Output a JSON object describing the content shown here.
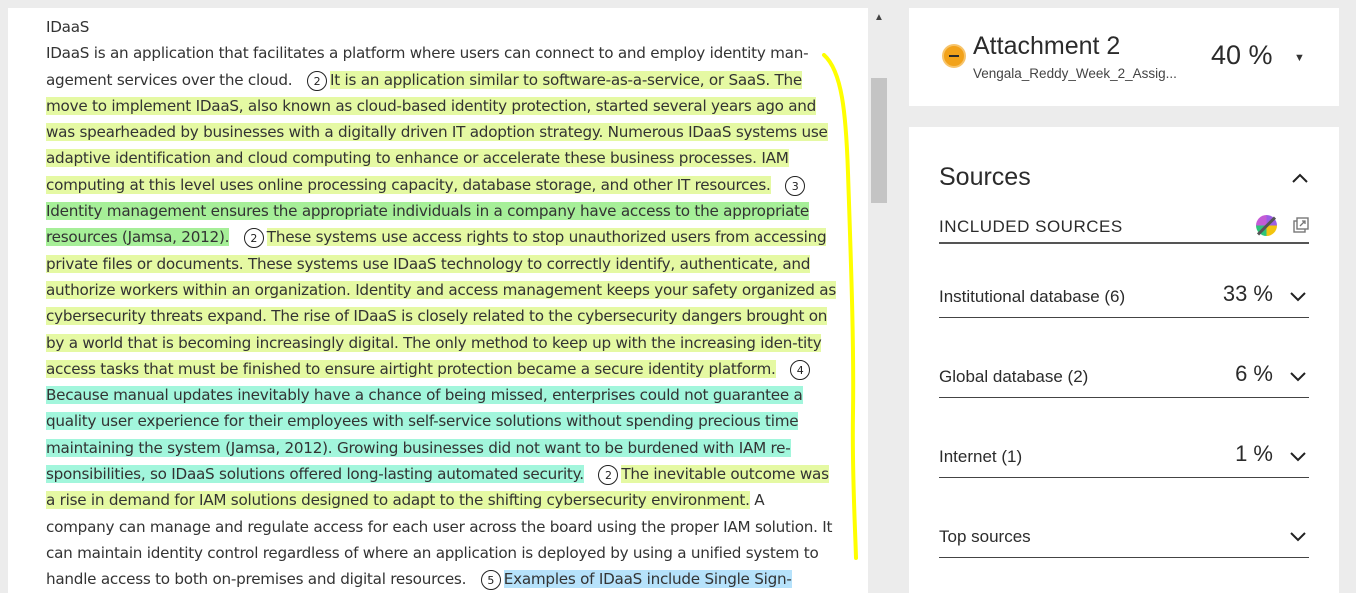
{
  "document": {
    "heading": "IDaaS",
    "segments": [
      {
        "text": "IDaaS is an application that facilitates a platform where users can connect to and employ identity man-agement services over the cloud."
      },
      {
        "marker": "2"
      },
      {
        "text": "It is an application similar to software-as-a-service, or SaaS. The move to implement IDaaS, also known as cloud-based identity protection, started several years ago and was spearheaded by businesses with a digitally driven IT adoption strategy. Numerous IDaaS systems use adaptive identification and cloud computing to enhance or accelerate these business processes. IAM computing at this level uses online processing capacity, database storage, and other IT resources.",
        "hl": "2"
      },
      {
        "marker": "3"
      },
      {
        "text": "Identity management ensures the appropriate individuals in a company have access to the appropriate resources (Jamsa, 2012).",
        "hl": "3"
      },
      {
        "marker": "2"
      },
      {
        "text": "These systems use access rights to stop unauthorized users from accessing private files or documents. These systems use IDaaS technology to correctly identify, authenticate, and authorize workers within an organization. Identity and access management keeps your safety organized as cybersecurity threats expand. The rise of IDaaS is closely related to the cybersecurity dangers brought on by a world that is becoming increasingly digital. The only method to keep up with the increasing iden-tity access tasks that must be finished to ensure airtight protection became a secure identity platform.",
        "hl": "2"
      },
      {
        "marker": "4"
      },
      {
        "text": "Because manual updates inevitably have a chance of being missed, enterprises could not guarantee a quality user experience for their employees with self-service solutions without spending precious time maintaining the system (Jamsa, 2012). Growing businesses did not want to be burdened with IAM re-sponsibilities, so IDaaS solutions offered long-lasting automated security.",
        "hl": "4"
      },
      {
        "marker": "2"
      },
      {
        "text": "The inevitable outcome was a rise in demand for IAM solutions designed to adapt to the shifting cybersecurity environment.",
        "hl": "2"
      },
      {
        "text": "A company can manage and regulate access for each user across the board using the proper IAM solution. It can maintain identity control regardless of where an application is deployed by using a unified system to handle access to both on-premises and digital resources."
      },
      {
        "marker": "5"
      },
      {
        "text": "Examples of IDaaS include Single Sign-",
        "hl": "5"
      }
    ]
  },
  "attachment": {
    "title": "Attachment 2",
    "filename": "Vengala_Reddy_Week_2_Assig...",
    "percent": "40 %"
  },
  "sources": {
    "title": "Sources",
    "included_label": "INCLUDED SOURCES",
    "rows": [
      {
        "label": "Institutional database (6)",
        "percent": "33 %"
      },
      {
        "label": "Global database (2)",
        "percent": "6 %"
      },
      {
        "label": "Internet (1)",
        "percent": "1 %"
      },
      {
        "label": "Top sources",
        "percent": ""
      }
    ]
  },
  "colors": {
    "highlight_2": "#e5f9a3",
    "highlight_3": "#a6ef98",
    "highlight_4": "#a2f6dc",
    "highlight_5": "#b6e2fb",
    "annotation_stroke": "#ffff00",
    "attachment_icon": "#f2a21a"
  },
  "icons": {
    "attachment_status": "minus-circle-icon",
    "attachment_menu": "caret-down-icon",
    "sources_toggle": "chevron-up-icon",
    "filter": "filter-icon",
    "open_external": "external-link-icon",
    "row_expand": "chevron-down-icon",
    "scroll_up": "scroll-up-arrow-icon"
  }
}
